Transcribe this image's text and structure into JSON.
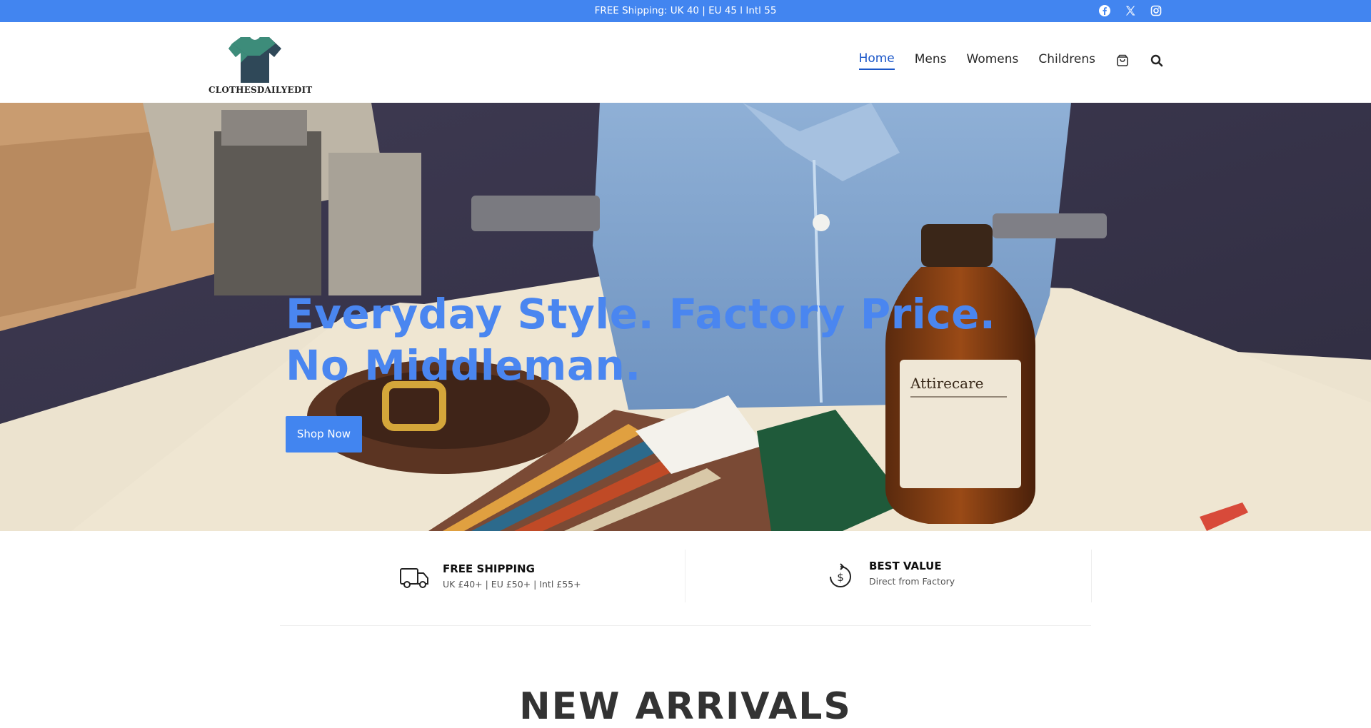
{
  "topbar": {
    "message": "FREE Shipping: UK   40 | EU   45 l Intl   55",
    "social": [
      "facebook-icon",
      "x-icon",
      "instagram-icon"
    ]
  },
  "header": {
    "logo_text": "CLOTHESDAILYEDIT",
    "nav": [
      {
        "label": "Home",
        "active": true
      },
      {
        "label": "Mens",
        "active": false
      },
      {
        "label": "Womens",
        "active": false
      },
      {
        "label": "Childrens",
        "active": false
      }
    ],
    "icons": [
      "cart-icon",
      "search-icon"
    ]
  },
  "hero": {
    "headline": "Everyday Style. Factory Price. No Middleman.",
    "button_label": "Shop Now"
  },
  "features": [
    {
      "title": "FREE SHIPPING",
      "subtitle": "UK £40+ | EU £50+ | Intl £55+",
      "icon": "truck-icon"
    },
    {
      "title": "BEST VALUE",
      "subtitle": "Direct from Factory",
      "icon": "dollar-cycle-icon"
    }
  ],
  "section": {
    "heading": "NEW ARRIVALS"
  },
  "colors": {
    "accent": "#4285f0",
    "nav_active": "#1a56c8",
    "headline": "#4a86f0"
  }
}
